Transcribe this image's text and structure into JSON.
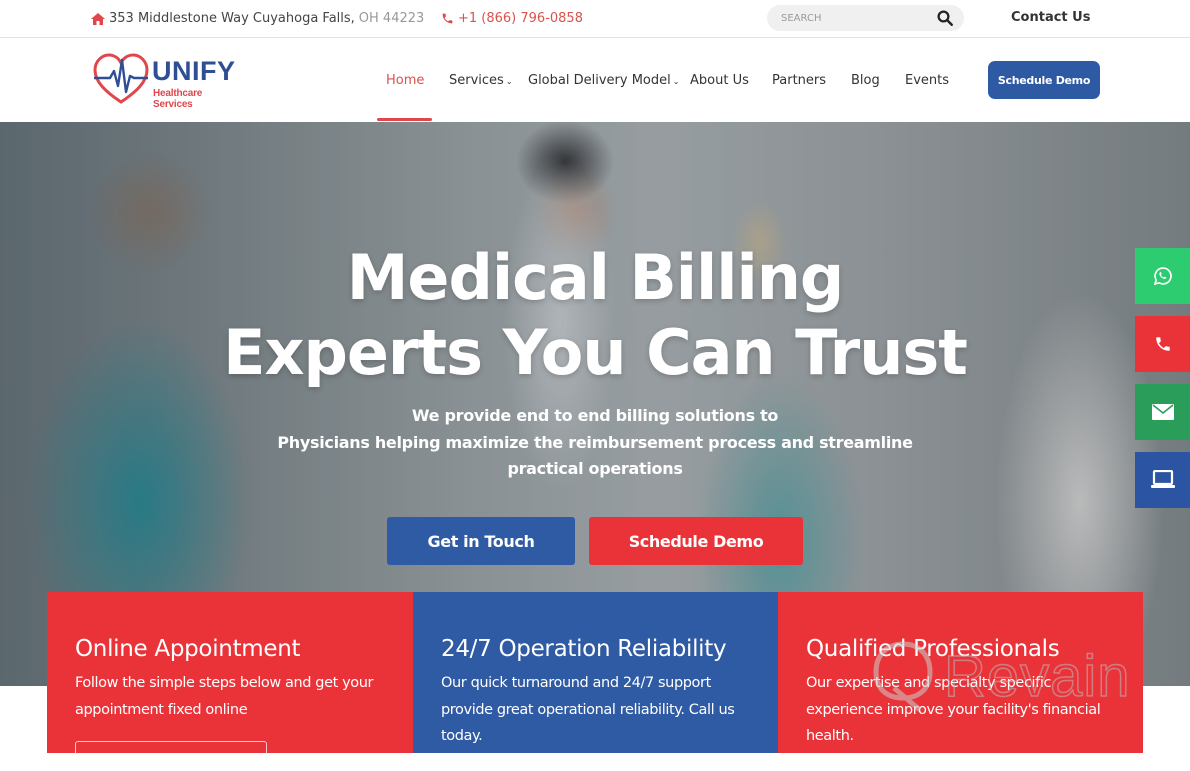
{
  "topbar": {
    "address_main": "353 Middlestone Way Cuyahoga Falls,",
    "address_tail": "OH 44223",
    "phone": "+1 (866) 796-0858",
    "search_placeholder": "SEARCH",
    "contact_label": "Contact Us"
  },
  "header": {
    "logo_brand": "UNIFY",
    "logo_sub": "Healthcare Services",
    "nav": [
      {
        "label": "Home",
        "active": true
      },
      {
        "label": "Services",
        "dropdown": true
      },
      {
        "label": "Global Delivery Model",
        "dropdown": true
      },
      {
        "label": "About Us"
      },
      {
        "label": "Partners"
      },
      {
        "label": "Blog"
      },
      {
        "label": "Events"
      }
    ],
    "caret": "⌄",
    "demo_button": "Schedule Demo"
  },
  "hero": {
    "title_line1": "Medical Billing",
    "title_line2": "Experts You Can Trust",
    "subtitle_line1": "We provide end to end billing solutions to",
    "subtitle_line2": "Physicians helping maximize the reimbursement process and streamline",
    "subtitle_line3": "practical operations",
    "btn_touch": "Get in Touch",
    "btn_demo": "Schedule Demo"
  },
  "floats": [
    {
      "name": "whatsapp",
      "color": "#2ecc71"
    },
    {
      "name": "phone",
      "color": "#e93339"
    },
    {
      "name": "email",
      "color": "#2a9d5a"
    },
    {
      "name": "laptop",
      "color": "#2b55a3"
    }
  ],
  "cards": [
    {
      "title": "Online Appointment",
      "desc_line1": "Follow the simple steps below and get your",
      "desc_line2": "appointment fixed online",
      "desc_line3": "",
      "color": "#ea3339"
    },
    {
      "title": "24/7 Operation Reliability",
      "desc_line1": "Our quick turnaround and 24/7 support",
      "desc_line2": "provide great operational reliability. Call us",
      "desc_line3": "today.",
      "color": "#2f5aa4"
    },
    {
      "title": "Qualified Professionals",
      "desc_line1": "Our expertise and specialty specific",
      "desc_line2": "experience improve your facility's financial",
      "desc_line3": "health.",
      "color": "#ea3339"
    }
  ],
  "watermark": {
    "text": "Revain"
  },
  "colors": {
    "brand_blue": "#2e5aa3",
    "brand_red": "#e93339",
    "accent_red": "#d9534f"
  }
}
